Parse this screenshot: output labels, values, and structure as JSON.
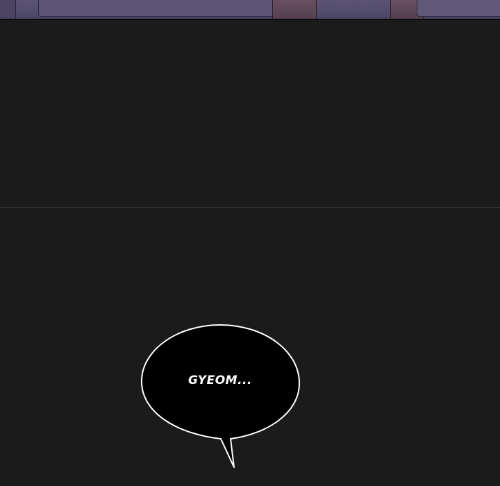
{
  "speech_bubble": {
    "text": "GYEOM..."
  },
  "colors": {
    "background": "#1b1b1b",
    "top_panel": "#534c6c",
    "divider": "#3a3a3a",
    "bubble_fill": "#000000",
    "bubble_outline": "#ffffff",
    "text": "#ffffff"
  }
}
